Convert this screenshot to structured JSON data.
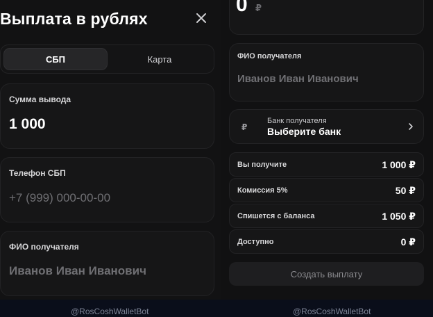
{
  "left": {
    "title": "Выплата в рублях",
    "tabs": [
      "СБП",
      "Карта"
    ],
    "amount": {
      "label": "Сумма вывода",
      "value": "1 000"
    },
    "phone": {
      "label": "Телефон СБП",
      "placeholder": "+7 (999) 000-00-00"
    },
    "name": {
      "label": "ФИО получателя",
      "placeholder": "Иванов Иван Иванович"
    }
  },
  "right": {
    "top_amount": "0",
    "currency": "₽",
    "name": {
      "label": "ФИО получателя",
      "placeholder": "Иванов Иван Иванович"
    },
    "bank": {
      "icon": "₽",
      "label": "Банк получателя",
      "value": "Выберите банк"
    },
    "summary": [
      {
        "label": "Вы получите",
        "value": "1 000 ₽"
      },
      {
        "label": "Комиссия 5%",
        "value": "50 ₽"
      },
      {
        "label": "Спишется с баланса",
        "value": "1 050 ₽"
      },
      {
        "label": "Доступно",
        "value": "0 ₽"
      }
    ],
    "create_button": "Создать выплату"
  },
  "footer": {
    "bot_left": "@RosCoshWalletBot",
    "bot_right": "@RosCoshWalletBot"
  }
}
